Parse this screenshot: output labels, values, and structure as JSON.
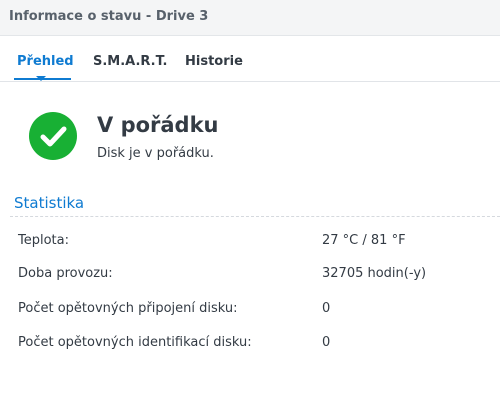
{
  "window": {
    "title": "Informace o stavu - Drive 3"
  },
  "tabs": [
    {
      "label": "Přehled",
      "active": true
    },
    {
      "label": "S.M.A.R.T.",
      "active": false
    },
    {
      "label": "Historie",
      "active": false
    }
  ],
  "status": {
    "icon": "check-circle-icon",
    "color": "#18b034",
    "title": "V pořádku",
    "description": "Disk je v pořádku."
  },
  "statistics": {
    "section_title": "Statistika",
    "rows": [
      {
        "label": "Teplota:",
        "value": "27 °C / 81 °F"
      },
      {
        "label": "Doba provozu:",
        "value": "32705 hodin(-y)"
      },
      {
        "label": "Počet opětovných připojení disku:",
        "value": "0"
      },
      {
        "label": "Počet opětovných identifikací disku:",
        "value": "0"
      }
    ]
  },
  "colors": {
    "accent": "#0f7bd1",
    "text": "#333b44",
    "titlebar_bg": "#f4f5f6"
  }
}
